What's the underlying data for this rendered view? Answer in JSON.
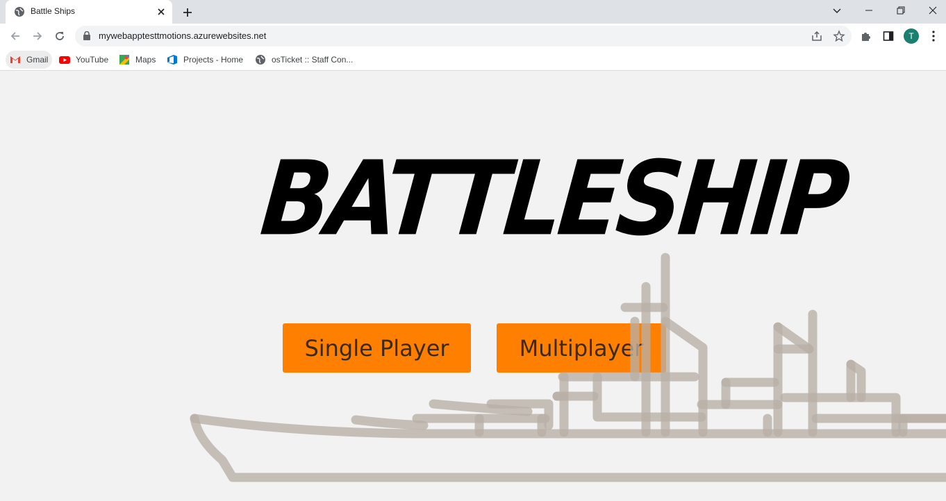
{
  "browser": {
    "tab": {
      "title": "Battle Ships"
    },
    "address_bar": {
      "url": "mywebapptesttmotions.azurewebsites.net"
    },
    "profile": {
      "initial": "T"
    },
    "bookmarks": [
      {
        "label": "Gmail",
        "icon": "gmail-icon"
      },
      {
        "label": "YouTube",
        "icon": "youtube-icon"
      },
      {
        "label": "Maps",
        "icon": "maps-icon"
      },
      {
        "label": "Projects - Home",
        "icon": "azure-devops-icon"
      },
      {
        "label": "osTicket :: Staff Con...",
        "icon": "globe-icon"
      }
    ]
  },
  "game": {
    "title": "BATTLESHIP",
    "buttons": {
      "single_player": "Single Player",
      "multiplayer": "Multiplayer"
    },
    "colors": {
      "button": "#ff7f00",
      "ship_outline": "#c2bab2",
      "background": "#f2f2f2"
    }
  }
}
